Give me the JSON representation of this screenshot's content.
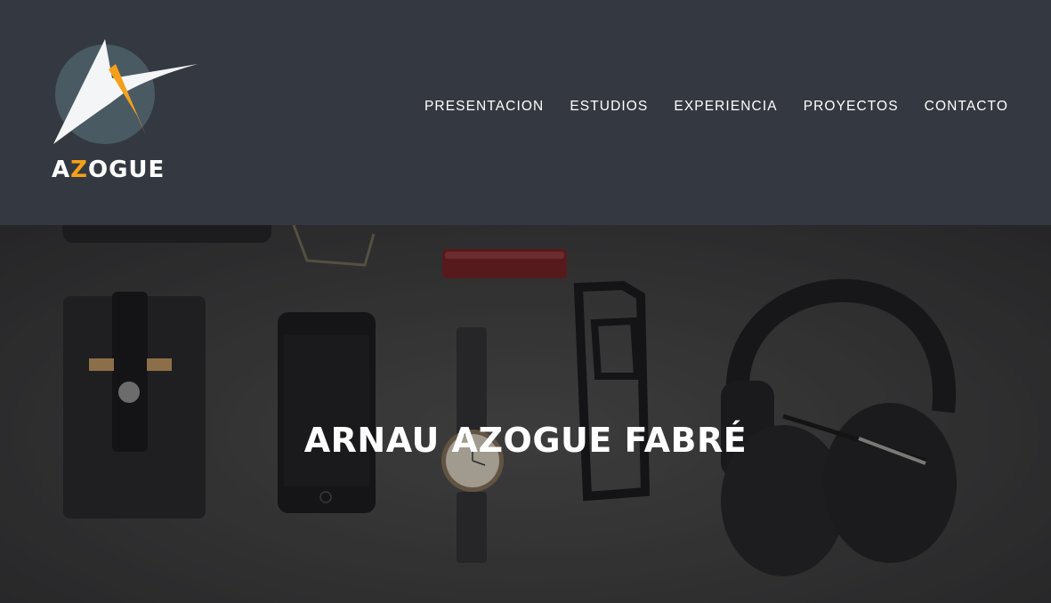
{
  "brand": {
    "logo_text_a": "A",
    "logo_text_z": "Z",
    "logo_text_rest": "OGUE",
    "accent_color": "#f5a01a"
  },
  "nav": {
    "items": [
      {
        "label": "PRESENTACION"
      },
      {
        "label": "ESTUDIOS"
      },
      {
        "label": "EXPERIENCIA"
      },
      {
        "label": "PROYECTOS"
      },
      {
        "label": "CONTACTO"
      }
    ]
  },
  "hero": {
    "title": "ARNAU AZOGUE FABRÉ"
  },
  "colors": {
    "header_bg": "#343941",
    "text": "#ffffff"
  }
}
